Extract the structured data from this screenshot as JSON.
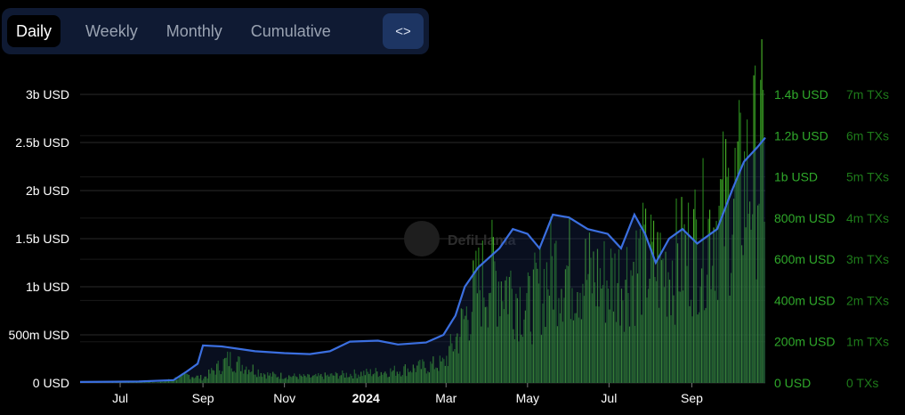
{
  "tabs": [
    {
      "label": "Daily",
      "active": true
    },
    {
      "label": "Weekly",
      "active": false
    },
    {
      "label": "Monthly",
      "active": false
    },
    {
      "label": "Cumulative",
      "active": false
    }
  ],
  "embed_icon": "code-brackets-icon",
  "watermark": "DefiLlama",
  "colors": {
    "background": "#000000",
    "tvl_line": "#3b6fe0",
    "volume_bars": "#2a8a1e",
    "tx_bars": "#4dbb2a",
    "right_axis_text": "#2fa82a",
    "left_axis_text": "#ffffff",
    "grid": "#2a2a2a"
  },
  "chart_data": {
    "type": "line+bar",
    "x_axis": {
      "ticks": [
        "Jul",
        "Sep",
        "Nov",
        "2024",
        "Mar",
        "May",
        "Jul",
        "Sep"
      ],
      "tick_dates": [
        "2023-07-01",
        "2023-09-01",
        "2023-11-01",
        "2024-01-01",
        "2024-03-01",
        "2024-05-01",
        "2024-07-01",
        "2024-09-01"
      ],
      "bold_tick": "2024",
      "range": [
        "2023-06-01",
        "2024-10-26"
      ]
    },
    "y_axes": [
      {
        "position": "left",
        "ticks": [
          "0 USD",
          "500m USD",
          "1b USD",
          "1.5b USD",
          "2b USD",
          "2.5b USD",
          "3b USD"
        ],
        "range": [
          0,
          3000000000
        ]
      },
      {
        "position": "right",
        "ticks": [
          "0 USD",
          "200m USD",
          "400m USD",
          "600m USD",
          "800m USD",
          "1b USD",
          "1.2b USD",
          "1.4b USD"
        ],
        "range": [
          0,
          1400000000
        ]
      },
      {
        "position": "right-outer",
        "ticks": [
          "0 TXs",
          "1m TXs",
          "2m TXs",
          "3m TXs",
          "4m TXs",
          "5m TXs",
          "6m TXs",
          "7m TXs"
        ],
        "range": [
          0,
          7000000
        ]
      }
    ],
    "grid": true,
    "series": [
      {
        "type": "line",
        "axis": "left",
        "points": [
          [
            "2023-06-01",
            10000000
          ],
          [
            "2023-07-15",
            15000000
          ],
          [
            "2023-08-10",
            30000000
          ],
          [
            "2023-08-20",
            120000000
          ],
          [
            "2023-08-28",
            200000000
          ],
          [
            "2023-09-01",
            390000000
          ],
          [
            "2023-09-15",
            380000000
          ],
          [
            "2023-09-25",
            360000000
          ],
          [
            "2023-10-10",
            330000000
          ],
          [
            "2023-11-01",
            310000000
          ],
          [
            "2023-11-20",
            300000000
          ],
          [
            "2023-12-05",
            330000000
          ],
          [
            "2023-12-20",
            430000000
          ],
          [
            "2024-01-10",
            440000000
          ],
          [
            "2024-01-25",
            400000000
          ],
          [
            "2024-02-15",
            420000000
          ],
          [
            "2024-02-28",
            500000000
          ],
          [
            "2024-03-08",
            700000000
          ],
          [
            "2024-03-15",
            1000000000
          ],
          [
            "2024-03-25",
            1200000000
          ],
          [
            "2024-04-10",
            1400000000
          ],
          [
            "2024-04-20",
            1600000000
          ],
          [
            "2024-05-01",
            1550000000
          ],
          [
            "2024-05-10",
            1400000000
          ],
          [
            "2024-05-20",
            1750000000
          ],
          [
            "2024-06-01",
            1720000000
          ],
          [
            "2024-06-15",
            1600000000
          ],
          [
            "2024-06-30",
            1550000000
          ],
          [
            "2024-07-10",
            1400000000
          ],
          [
            "2024-07-20",
            1750000000
          ],
          [
            "2024-07-28",
            1550000000
          ],
          [
            "2024-08-05",
            1250000000
          ],
          [
            "2024-08-15",
            1500000000
          ],
          [
            "2024-08-25",
            1600000000
          ],
          [
            "2024-09-05",
            1450000000
          ],
          [
            "2024-09-20",
            1600000000
          ],
          [
            "2024-10-01",
            2000000000
          ],
          [
            "2024-10-10",
            2300000000
          ],
          [
            "2024-10-20",
            2450000000
          ],
          [
            "2024-10-26",
            2550000000
          ]
        ]
      },
      {
        "type": "bar",
        "axis": "right",
        "points": [
          [
            "2023-06-01",
            0
          ],
          [
            "2023-08-01",
            5000000
          ],
          [
            "2023-08-20",
            40000000
          ],
          [
            "2023-09-01",
            25000000
          ],
          [
            "2023-09-20",
            120000000
          ],
          [
            "2023-10-01",
            90000000
          ],
          [
            "2023-10-20",
            40000000
          ],
          [
            "2023-11-20",
            30000000
          ],
          [
            "2023-12-20",
            45000000
          ],
          [
            "2024-01-20",
            60000000
          ],
          [
            "2024-02-10",
            80000000
          ],
          [
            "2024-02-28",
            100000000
          ],
          [
            "2024-03-10",
            250000000
          ],
          [
            "2024-03-25",
            500000000
          ],
          [
            "2024-04-05",
            560000000
          ],
          [
            "2024-04-20",
            480000000
          ],
          [
            "2024-05-01",
            380000000
          ],
          [
            "2024-05-20",
            600000000
          ],
          [
            "2024-06-10",
            560000000
          ],
          [
            "2024-06-25",
            520000000
          ],
          [
            "2024-07-10",
            540000000
          ],
          [
            "2024-07-25",
            620000000
          ],
          [
            "2024-08-10",
            580000000
          ],
          [
            "2024-08-25",
            650000000
          ],
          [
            "2024-09-10",
            760000000
          ],
          [
            "2024-09-25",
            880000000
          ],
          [
            "2024-10-10",
            1000000000
          ],
          [
            "2024-10-26",
            1200000000
          ]
        ]
      }
    ]
  }
}
